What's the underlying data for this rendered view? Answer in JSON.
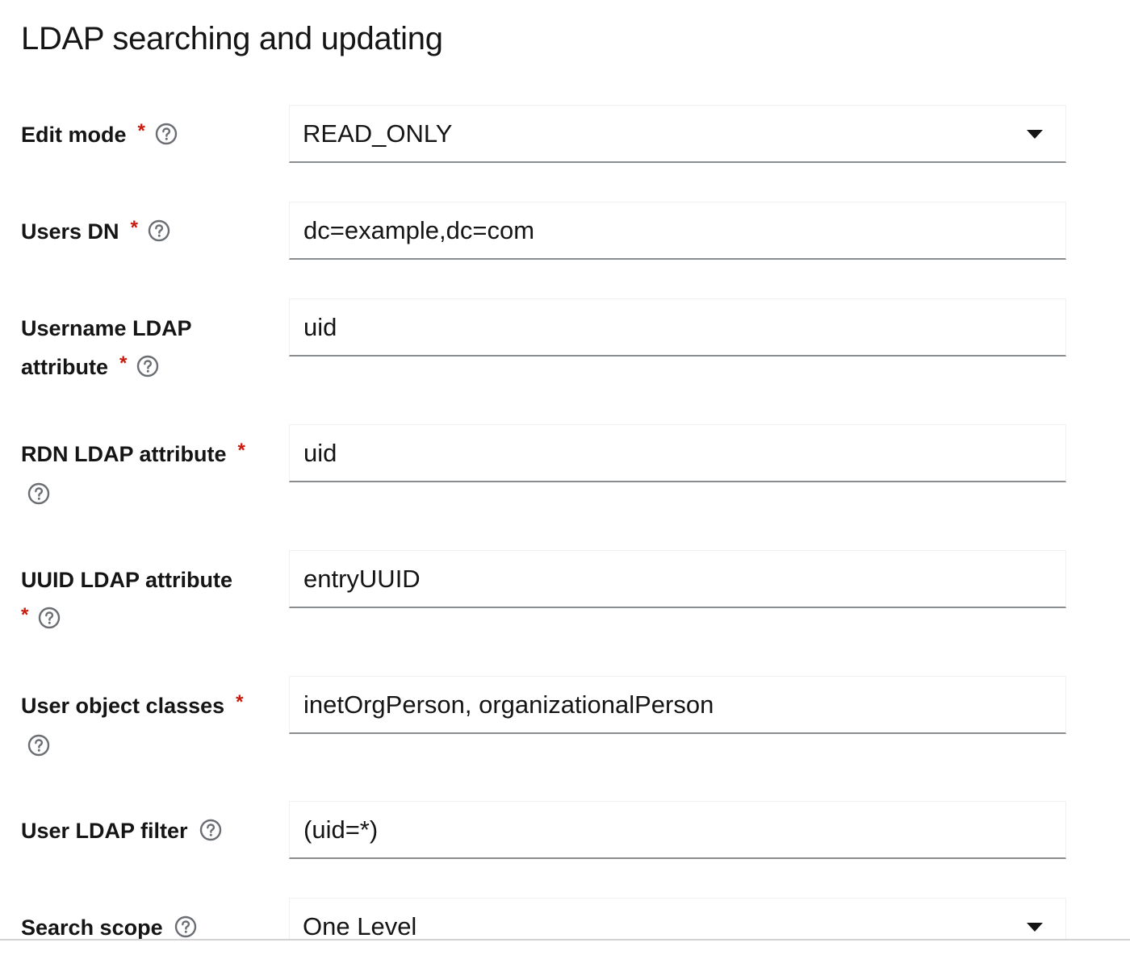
{
  "section": {
    "title": "LDAP searching and updating"
  },
  "fields": {
    "edit_mode": {
      "label": "Edit mode",
      "required_mark": "*",
      "value": "READ_ONLY",
      "help_icon": "question-circle-icon"
    },
    "users_dn": {
      "label": "Users DN",
      "required_mark": "*",
      "value": "dc=example,dc=com",
      "help_icon": "question-circle-icon"
    },
    "username_ldap_attribute": {
      "label_line1": "Username LDAP",
      "label_line2": "attribute",
      "required_mark": "*",
      "value": "uid",
      "help_icon": "question-circle-icon"
    },
    "rdn_ldap_attribute": {
      "label": "RDN LDAP attribute",
      "required_mark": "*",
      "value": "uid",
      "help_icon": "question-circle-icon"
    },
    "uuid_ldap_attribute": {
      "label": "UUID LDAP attribute",
      "required_mark": "*",
      "value": "entryUUID",
      "help_icon": "question-circle-icon"
    },
    "user_object_classes": {
      "label": "User object classes",
      "required_mark": "*",
      "value": "inetOrgPerson, organizationalPerson",
      "help_icon": "question-circle-icon"
    },
    "user_ldap_filter": {
      "label": "User LDAP filter",
      "value": "(uid=*)",
      "help_icon": "question-circle-icon"
    },
    "search_scope": {
      "label": "Search scope",
      "value": "One Level",
      "help_icon": "question-circle-icon"
    }
  },
  "colors": {
    "required": "#c9190b",
    "text": "#151515",
    "field_border_bottom": "#8a8d90",
    "icon": "#6a6e73"
  }
}
